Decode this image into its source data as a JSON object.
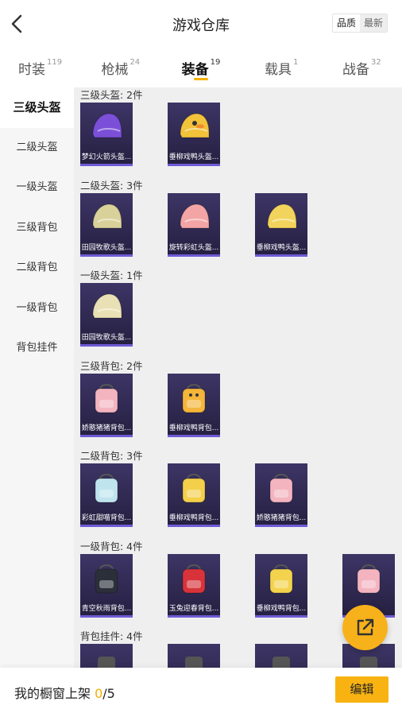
{
  "header": {
    "title": "游戏仓库",
    "sort_quality": "品质",
    "sort_newest": "最新"
  },
  "tabs": [
    {
      "label": "时装",
      "count": "119"
    },
    {
      "label": "枪械",
      "count": "24"
    },
    {
      "label": "装备",
      "count": "19"
    },
    {
      "label": "载具",
      "count": "1"
    },
    {
      "label": "战备",
      "count": "32"
    }
  ],
  "active_tab": "装备",
  "sidebar": {
    "items": [
      {
        "label": "三级头盔"
      },
      {
        "label": "二级头盔"
      },
      {
        "label": "一级头盔"
      },
      {
        "label": "三级背包"
      },
      {
        "label": "二级背包"
      },
      {
        "label": "一级背包"
      },
      {
        "label": "背包挂件"
      }
    ]
  },
  "sections": [
    {
      "title": "三级头盔: 2件",
      "items": [
        {
          "name": "梦幻火箭头盔...",
          "icon": "helmet-icon",
          "color": "#7b4fd8"
        },
        {
          "name": "垂柳戏鸭头盔...",
          "icon": "duck-helmet-icon",
          "color": "#f2c23a"
        }
      ]
    },
    {
      "title": "二级头盔: 3件",
      "items": [
        {
          "name": "田园牧歌头盔...",
          "icon": "helmet-icon",
          "color": "#d8d29a"
        },
        {
          "name": "旋转彩虹头盔...",
          "icon": "helmet-icon",
          "color": "#f3a5a5"
        },
        {
          "name": "垂柳戏鸭头盔...",
          "icon": "helmet-icon",
          "color": "#f2d45c"
        }
      ]
    },
    {
      "title": "一级头盔: 1件",
      "items": [
        {
          "name": "田园牧歌头盔...",
          "icon": "helmet-icon",
          "color": "#e9e1b5"
        }
      ]
    },
    {
      "title": "三级背包: 2件",
      "items": [
        {
          "name": "娇憨猪猪背包...",
          "icon": "backpack-icon",
          "color": "#f3b4c0"
        },
        {
          "name": "垂柳戏鸭背包...",
          "icon": "duck-backpack-icon",
          "color": "#f4b53a"
        }
      ]
    },
    {
      "title": "二级背包: 3件",
      "items": [
        {
          "name": "彩虹甜喵背包...",
          "icon": "backpack-icon",
          "color": "#bfe4ee"
        },
        {
          "name": "垂柳戏鸭背包...",
          "icon": "backpack-icon",
          "color": "#f3cf4a"
        },
        {
          "name": "娇憨猪猪背包...",
          "icon": "backpack-icon",
          "color": "#f3b4c0"
        }
      ]
    },
    {
      "title": "一级背包: 4件",
      "items": [
        {
          "name": "青空秋雨背包...",
          "icon": "backpack-icon",
          "color": "#2a2f3a"
        },
        {
          "name": "玉兔迎春背包...",
          "icon": "backpack-icon",
          "color": "#d8333a"
        },
        {
          "name": "垂柳戏鸭背包...",
          "icon": "backpack-icon",
          "color": "#f3d34e"
        },
        {
          "name": "",
          "icon": "backpack-icon",
          "color": "#f3b4c0"
        }
      ]
    },
    {
      "title": "背包挂件: 4件",
      "items": [
        {
          "name": "",
          "icon": "pendant-icon",
          "color": "#555"
        },
        {
          "name": "",
          "icon": "pendant-icon",
          "color": "#555"
        },
        {
          "name": "",
          "icon": "pendant-icon",
          "color": "#555"
        },
        {
          "name": "",
          "icon": "pendant-icon",
          "color": "#555"
        }
      ]
    }
  ],
  "footer": {
    "label_prefix": "我的橱窗上架 ",
    "count_current": "0",
    "count_total": "/5",
    "edit_label": "编辑"
  },
  "colors": {
    "accent": "#f5b000",
    "card_bg": "#2f2950",
    "card_border": "#6e5bd6"
  }
}
